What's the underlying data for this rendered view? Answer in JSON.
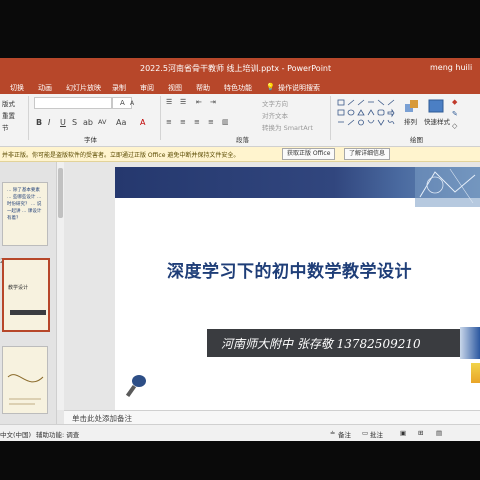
{
  "window": {
    "title": "2022.5河南省骨干教师 线上培训.pptx - PowerPoint",
    "user": "meng huili"
  },
  "ribbon_tabs": [
    "切换",
    "动画",
    "幻灯片放映",
    "录制",
    "审阅",
    "视图",
    "帮助",
    "特色功能",
    "操作说明搜索"
  ],
  "ribbon": {
    "layout_label": "版式",
    "reset_label": "重置",
    "section_label": "节",
    "font_group_label": "字体",
    "paragraph_group_label": "段落",
    "drawing_group_label": "绘图",
    "text_direction_label": "文字方向",
    "align_text_label": "对齐文本",
    "smartart_label": "转换为 SmartArt",
    "arrange_label": "排列",
    "quick_styles_label": "快速样式",
    "bold": "B",
    "italic": "I",
    "underline": "U",
    "strike": "S",
    "shadow": "ab",
    "spacing": "AV",
    "case": "Aa",
    "font_color": "A",
    "grow": "A",
    "shrink": "A"
  },
  "warning": {
    "text": "并非正版。你可能是盗版软件的受害者。立即通过正版 Office 避免中断并保持文件安全。",
    "genuine_button": "获取正版 Office",
    "learn_more_button": "了解详细信息"
  },
  "slide": {
    "title": "深度学习下的初中数学教学设计",
    "author_line": "河南师大附中    张存敬  13782509210"
  },
  "thumbnails": [
    {
      "text": "… 除了基本要素 … 些哪些设计 … 时份研究？ … 说一起讲 … 课设计有着？"
    },
    {
      "number": "2",
      "text": "教学设计"
    },
    {
      "text": ""
    }
  ],
  "notes_placeholder": "单击此处添加备注",
  "status": {
    "language": "中文(中国)",
    "accessibility": "辅助功能: 调查",
    "notes": "备注",
    "comments": "批注"
  },
  "colors": {
    "accent": "#b7472a",
    "slide_title": "#1f3e78",
    "author_bar": "#3a3c40"
  }
}
